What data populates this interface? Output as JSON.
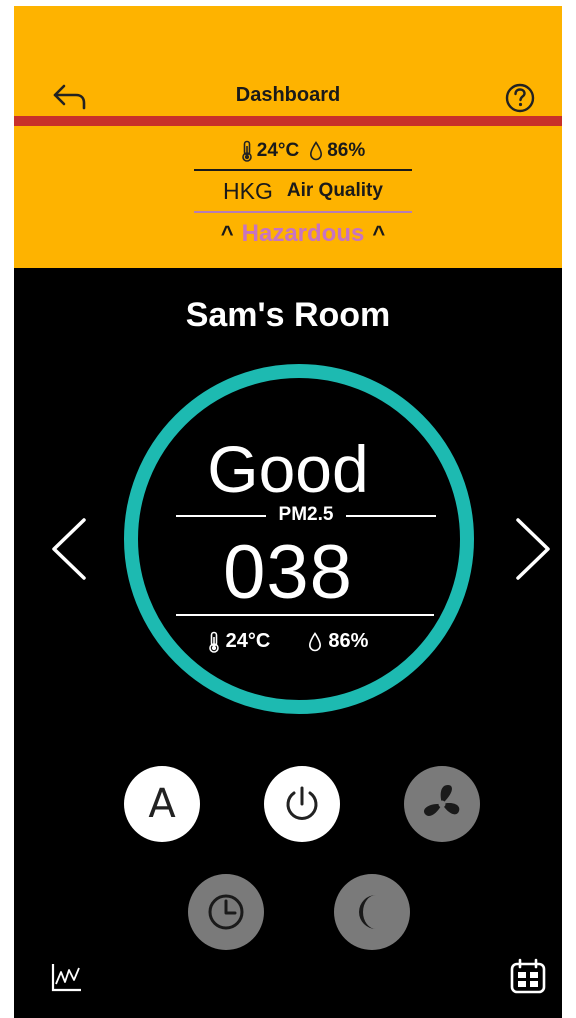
{
  "header": {
    "title": "Dashboard",
    "back_icon": "back-arrow-icon",
    "help_icon": "help-circle-icon"
  },
  "outdoor": {
    "temperature": "24°C",
    "humidity": "86%",
    "city": "HKG",
    "air_quality_label": "Air Quality",
    "status": "Hazardous",
    "caret_left": "^",
    "caret_right": "^"
  },
  "room": {
    "name": "Sam's Room",
    "status": "Good",
    "pm_label": "PM2.5",
    "pm_value": "038",
    "temperature": "24°C",
    "humidity": "86%"
  },
  "controls": {
    "auto_label": "A",
    "icons": [
      "power-icon",
      "fan-icon",
      "timer-icon",
      "sleep-moon-icon"
    ]
  },
  "footer": {
    "icons": [
      "chart-icon",
      "calendar-icon"
    ]
  },
  "colors": {
    "header_bg": "#FEB300",
    "stripe": "#C8302A",
    "ring": "#1DBAB1",
    "hazardous": "#C774C1",
    "inactive_button": "#7a7a7a"
  }
}
